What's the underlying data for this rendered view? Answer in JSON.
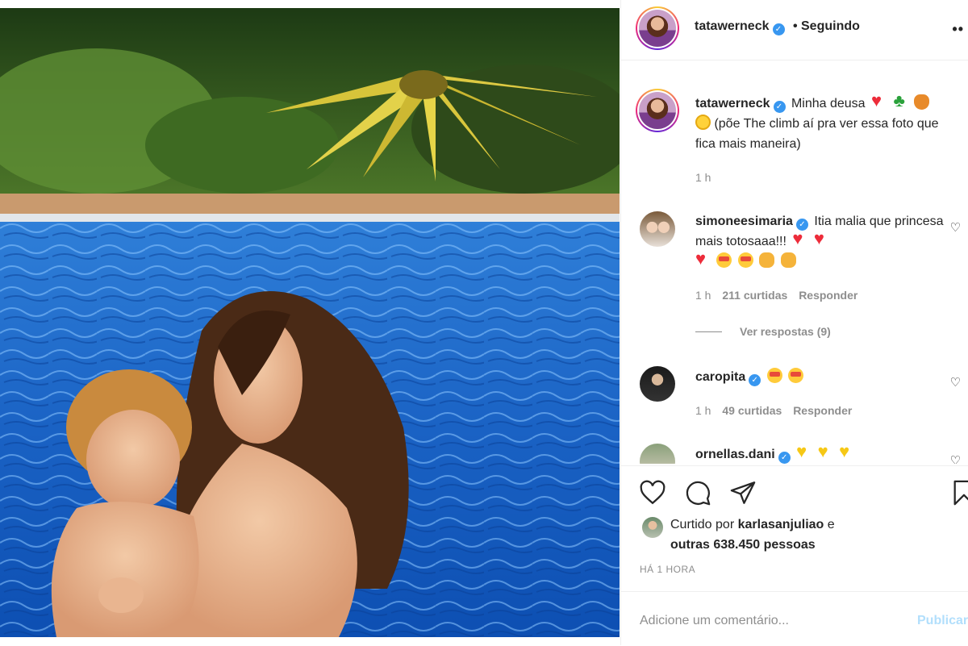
{
  "post": {
    "username": "tatawerneck",
    "follow_status": "• Seguindo",
    "more_icon": "more-horizontal-icon"
  },
  "caption": {
    "username": "tatawerneck",
    "text_a": "Minha deusa",
    "text_b": "(põe The climb aí pra ver essa foto que fica mais maneira)",
    "time": "1 h"
  },
  "comments": [
    {
      "username": "simoneesimaria",
      "text": "Itia malia que princesa mais totosaaa!!!",
      "time": "1 h",
      "likes": "211 curtidas",
      "reply": "Responder",
      "view_replies": "Ver respostas (9)"
    },
    {
      "username": "caropita",
      "text": "",
      "time": "1 h",
      "likes": "49 curtidas",
      "reply": "Responder"
    },
    {
      "username": "ornellas.dani",
      "text": ""
    }
  ],
  "likes": {
    "prefix": "Curtido por",
    "user": "karlasanjuliao",
    "suffix": "e",
    "others": "outras 638.450 pessoas"
  },
  "timestamp": "HÁ 1 HORA",
  "comment_box": {
    "placeholder": "Adicione um comentário...",
    "post_label": "Publicar"
  },
  "colors": {
    "verified": "#3897f0",
    "muted": "#8e8e8e",
    "post_button_disabled": "#b2dffc"
  }
}
